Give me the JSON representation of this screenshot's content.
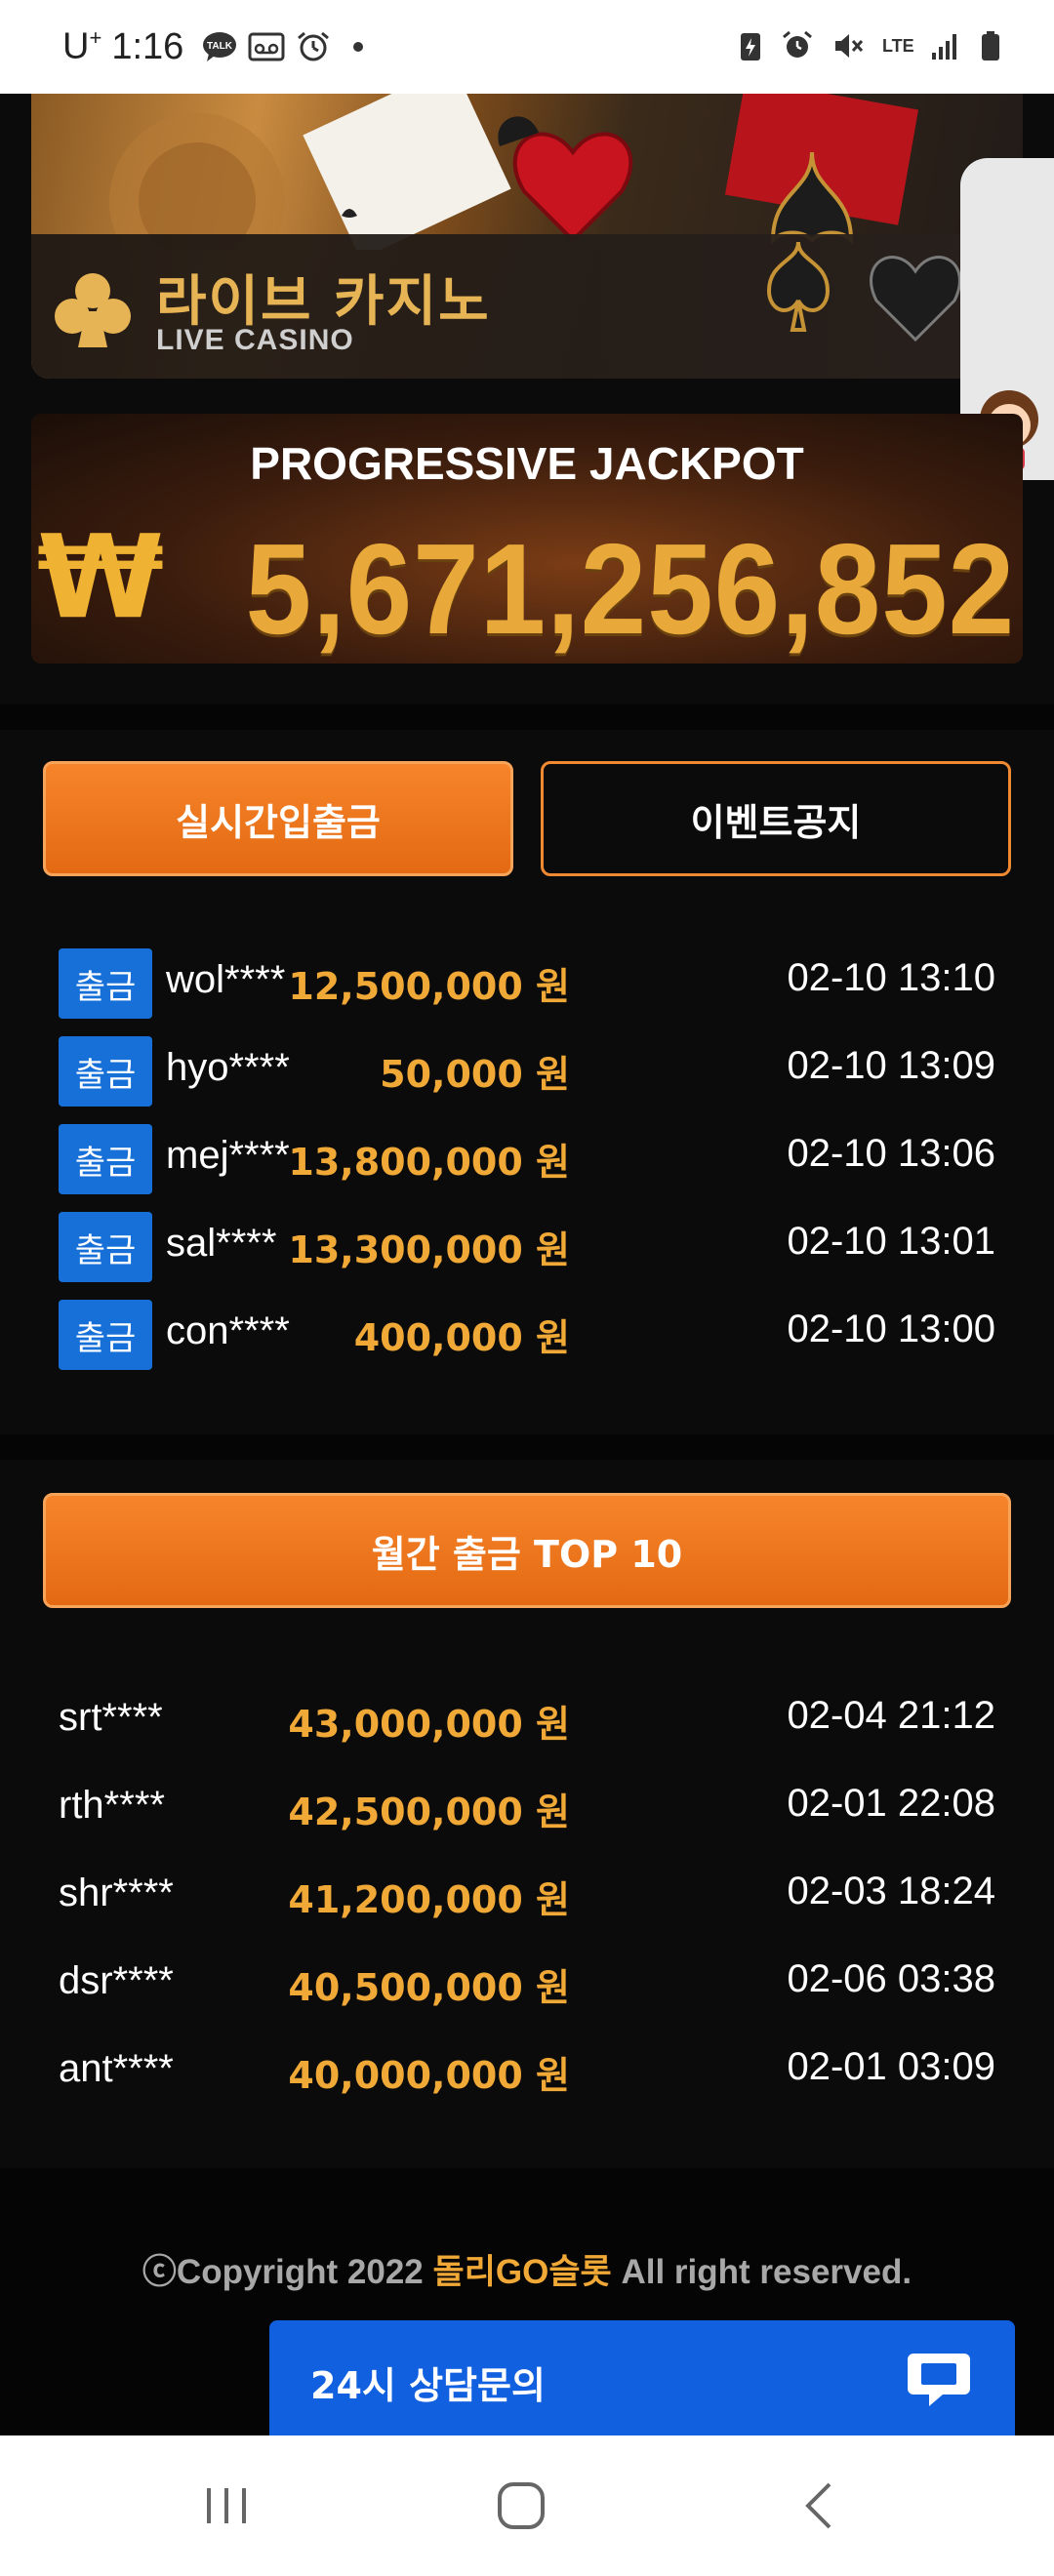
{
  "status_bar": {
    "carrier": "U",
    "carrier_plus": "+",
    "time": "1:16",
    "network": "LTE"
  },
  "live_casino": {
    "title": "라이브 카지노",
    "subtitle": "LIVE CASINO"
  },
  "jackpot": {
    "title": "PROGRESSIVE JACKPOT",
    "currency": "₩",
    "value": "5,671,256,852"
  },
  "tabs": {
    "realtime_label": "실시간입출금",
    "event_label": "이벤트공지"
  },
  "withdrawals": [
    {
      "badge": "출금",
      "user": "wol****",
      "amount": "12,500,000 원",
      "date": "02-10 13:10"
    },
    {
      "badge": "출금",
      "user": "hyo****",
      "amount": "50,000 원",
      "date": "02-10 13:09"
    },
    {
      "badge": "출금",
      "user": "mej****",
      "amount": "13,800,000 원",
      "date": "02-10 13:06"
    },
    {
      "badge": "출금",
      "user": "sal****",
      "amount": "13,300,000 원",
      "date": "02-10 13:01"
    },
    {
      "badge": "출금",
      "user": "con****",
      "amount": "400,000 원",
      "date": "02-10 13:00"
    }
  ],
  "top10": {
    "label": "월간 출금 TOP 10",
    "rows": [
      {
        "user": "srt****",
        "amount": "43,000,000 원",
        "date": "02-04 21:12"
      },
      {
        "user": "rth****",
        "amount": "42,500,000 원",
        "date": "02-01 22:08"
      },
      {
        "user": "shr****",
        "amount": "41,200,000 원",
        "date": "02-03 18:24"
      },
      {
        "user": "dsr****",
        "amount": "40,500,000 원",
        "date": "02-06 03:38"
      },
      {
        "user": "ant****",
        "amount": "40,000,000 원",
        "date": "02-01 03:09"
      }
    ]
  },
  "footer": {
    "copy_prefix": "ⓒCopyright 2022 ",
    "brand": "돌리GO슬롯",
    "copy_suffix": " All right reserved."
  },
  "chat": {
    "label": "24시 상담문의",
    "icon": "chat-bubble-icon"
  },
  "colors": {
    "accent_orange": "#f08a32",
    "amount_gold": "#f0a836",
    "badge_blue": "#1670d8",
    "chat_blue": "#1160e0"
  }
}
